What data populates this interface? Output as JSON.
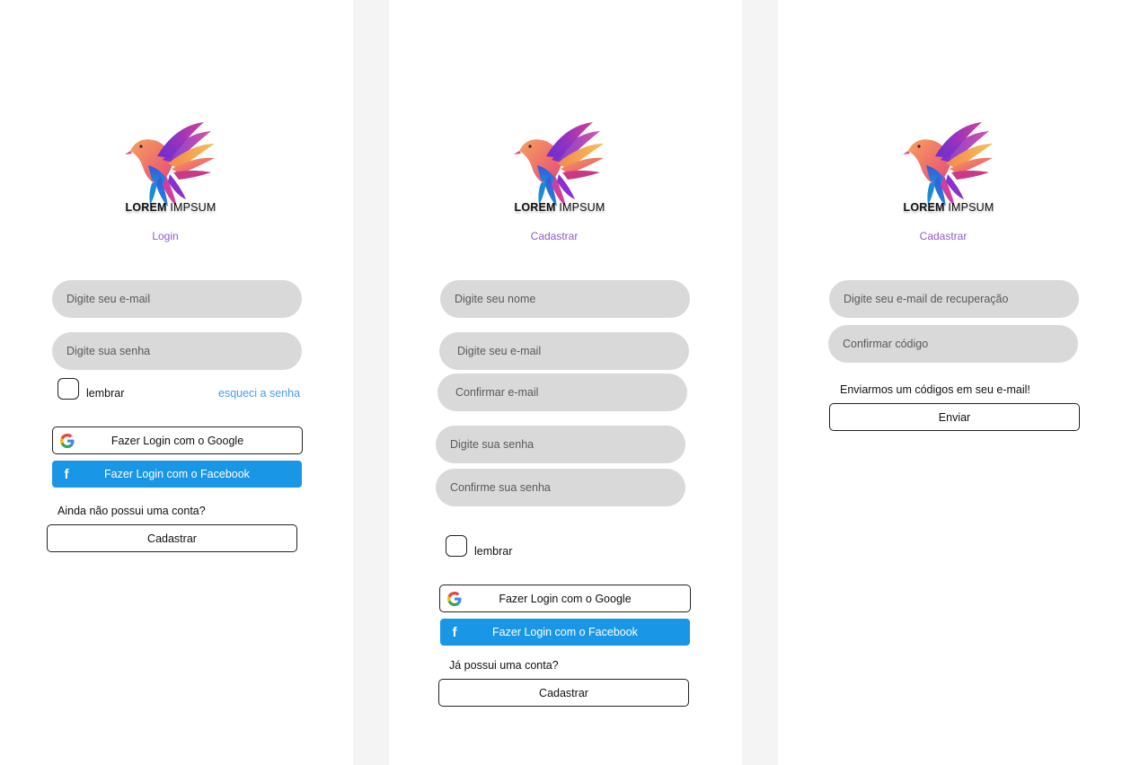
{
  "brand": {
    "bold": "LOREM",
    "regular": "IMPSUM"
  },
  "login": {
    "subtitle": "Login",
    "email_placeholder": "Digite seu e-mail",
    "password_placeholder": "Digite sua senha",
    "remember_label": "lembrar",
    "forgot_link": "esqueci a senha",
    "google_label": "Fazer Login com o Google",
    "facebook_label": "Fazer Login com o Facebook",
    "no_account_text": "Ainda não possui uma conta?",
    "register_label": "Cadastrar"
  },
  "register": {
    "subtitle": "Cadastrar",
    "name_placeholder": "Digite seu nome",
    "email_placeholder": "Digite seu e-mail",
    "confirm_email_placeholder": "Confirmar e-mail",
    "password_placeholder": "Digite sua senha",
    "confirm_password_placeholder": "Confirme sua senha",
    "remember_label": "lembrar",
    "google_label": "Fazer Login com o Google",
    "facebook_label": "Fazer Login com o Facebook",
    "has_account_text": "Já possui uma conta?",
    "register_label": "Cadastrar"
  },
  "recovery": {
    "subtitle": "Cadastrar",
    "recovery_email_placeholder": "Digite seu e-mail de recuperação",
    "confirm_code_placeholder": "Confirmar código",
    "sent_message": "Enviarmos um códigos em seu e-mail!",
    "send_label": "Enviar"
  },
  "colors": {
    "accent_purple": "#8e5cc7",
    "facebook_blue": "#1a96e6",
    "link_blue": "#4a9bf0",
    "field_gray": "#d9d9d9"
  },
  "icons": [
    "bird-logo-icon",
    "google-icon",
    "facebook-icon"
  ]
}
